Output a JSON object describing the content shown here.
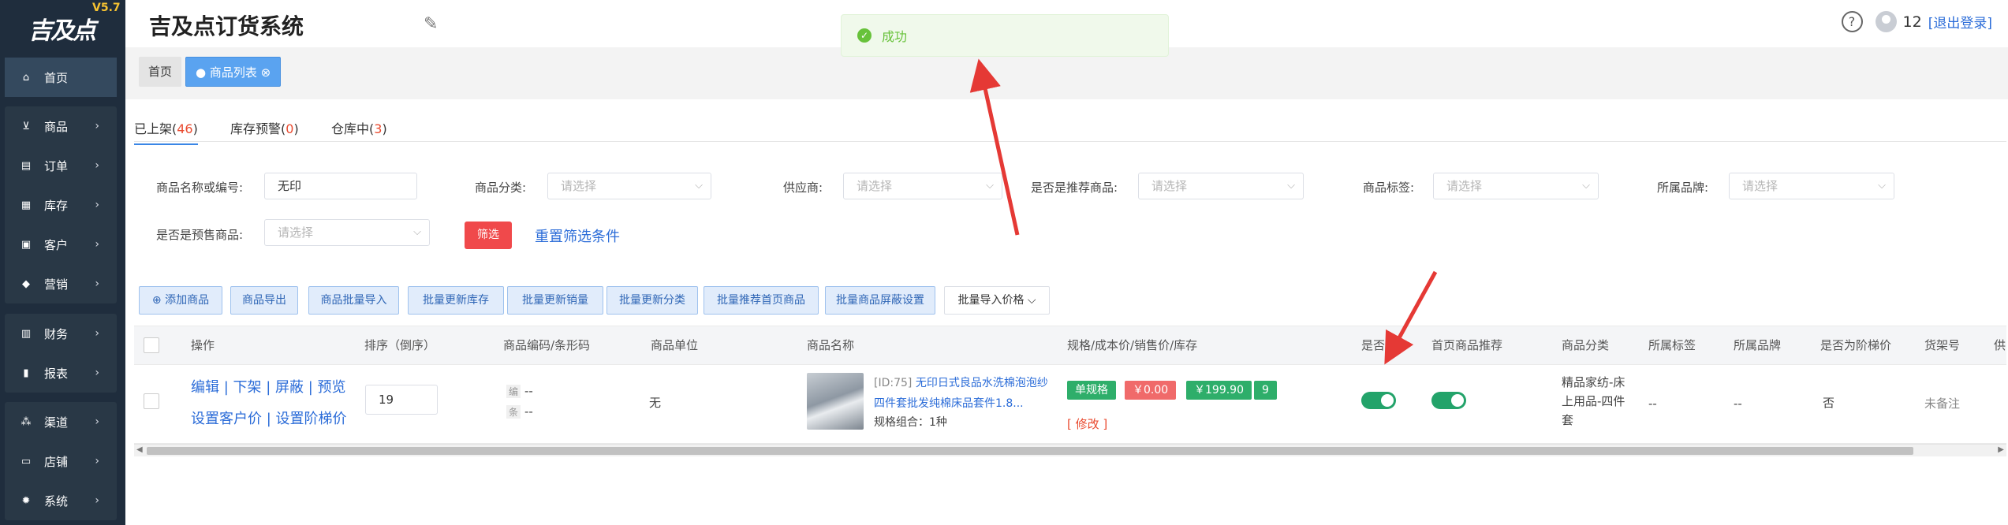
{
  "sidebar": {
    "logo": "吉及点",
    "version": "V5.7",
    "items": [
      {
        "label": "首页",
        "icon": "home-icon"
      },
      {
        "label": "商品",
        "icon": "cart-icon"
      },
      {
        "label": "订单",
        "icon": "order-icon"
      },
      {
        "label": "库存",
        "icon": "inventory-icon"
      },
      {
        "label": "客户",
        "icon": "customer-icon"
      },
      {
        "label": "营销",
        "icon": "tag-icon"
      },
      {
        "label": "财务",
        "icon": "finance-icon"
      },
      {
        "label": "报表",
        "icon": "chart-icon"
      },
      {
        "label": "渠道",
        "icon": "channel-icon"
      },
      {
        "label": "店铺",
        "icon": "store-icon"
      },
      {
        "label": "系统",
        "icon": "gear-icon"
      }
    ]
  },
  "header": {
    "title": "吉及点订货系统",
    "user": "12",
    "logout": "[退出登录]"
  },
  "toast": {
    "message": "成功"
  },
  "tags": {
    "home": "首页",
    "active": "● 商品列表 ⊗"
  },
  "tabs": [
    {
      "label": "已上架(",
      "count": "46",
      "close": ")"
    },
    {
      "label": "库存预警(",
      "count": "0",
      "close": ")"
    },
    {
      "label": "仓库中(",
      "count": "3",
      "close": ")"
    }
  ],
  "filters": {
    "name_label": "商品名称或编号:",
    "name_value": "无印",
    "category_label": "商品分类:",
    "supplier_label": "供应商:",
    "recommend_label": "是否是推荐商品:",
    "tag_label": "商品标签:",
    "brand_label": "所属品牌:",
    "presale_label": "是否是预售商品:",
    "placeholder": "请选择",
    "filter_button": "筛选",
    "reset_link": "重置筛选条件"
  },
  "actions": {
    "add": "⊕ 添加商品",
    "export": "商品导出",
    "import": "商品批量导入",
    "update_stock": "批量更新库存",
    "update_sales": "批量更新销量",
    "update_category": "批量更新分类",
    "recommend_home": "批量推荐首页商品",
    "hide": "批量商品屏蔽设置",
    "import_price": "批量导入价格 ⌵"
  },
  "table": {
    "headers": [
      "操作",
      "排序（倒序）",
      "商品编码/条形码",
      "商品单位",
      "商品名称",
      "规格/成本价/销售价/库存",
      "是否推",
      "首页商品推荐",
      "商品分类",
      "所属标签",
      "所属品牌",
      "是否为阶梯价",
      "货架号",
      "供"
    ],
    "row": {
      "ops_line1": "编辑 | 下架 | 屏蔽 | 预览",
      "ops_line2": "设置客户价  |  设置阶梯价",
      "sort": "19",
      "code_label": "编",
      "code_value": "--",
      "barcode_label": "条",
      "barcode_value": "--",
      "unit": "无",
      "name_id": "[ID:75]",
      "name": "无印日式良品水洗棉泡泡纱四件套批发纯棉床品套件1.8...",
      "spec_combo": "规格组合：1种",
      "spec_chip": "单规格",
      "cost_chip": "￥0.00",
      "price_chip": "￥199.90",
      "stock_chip": "9",
      "modify": "[ 修改 ]",
      "category": "精品家纺-床上用品-四件套",
      "tags": "--",
      "brand": "--",
      "tiered": "否",
      "shelf": "未备注"
    }
  },
  "colors": {
    "sidebar": "#1f2d3d",
    "accent": "#2b6cd8",
    "success": "#67c23a",
    "arrow": "#e53935"
  }
}
